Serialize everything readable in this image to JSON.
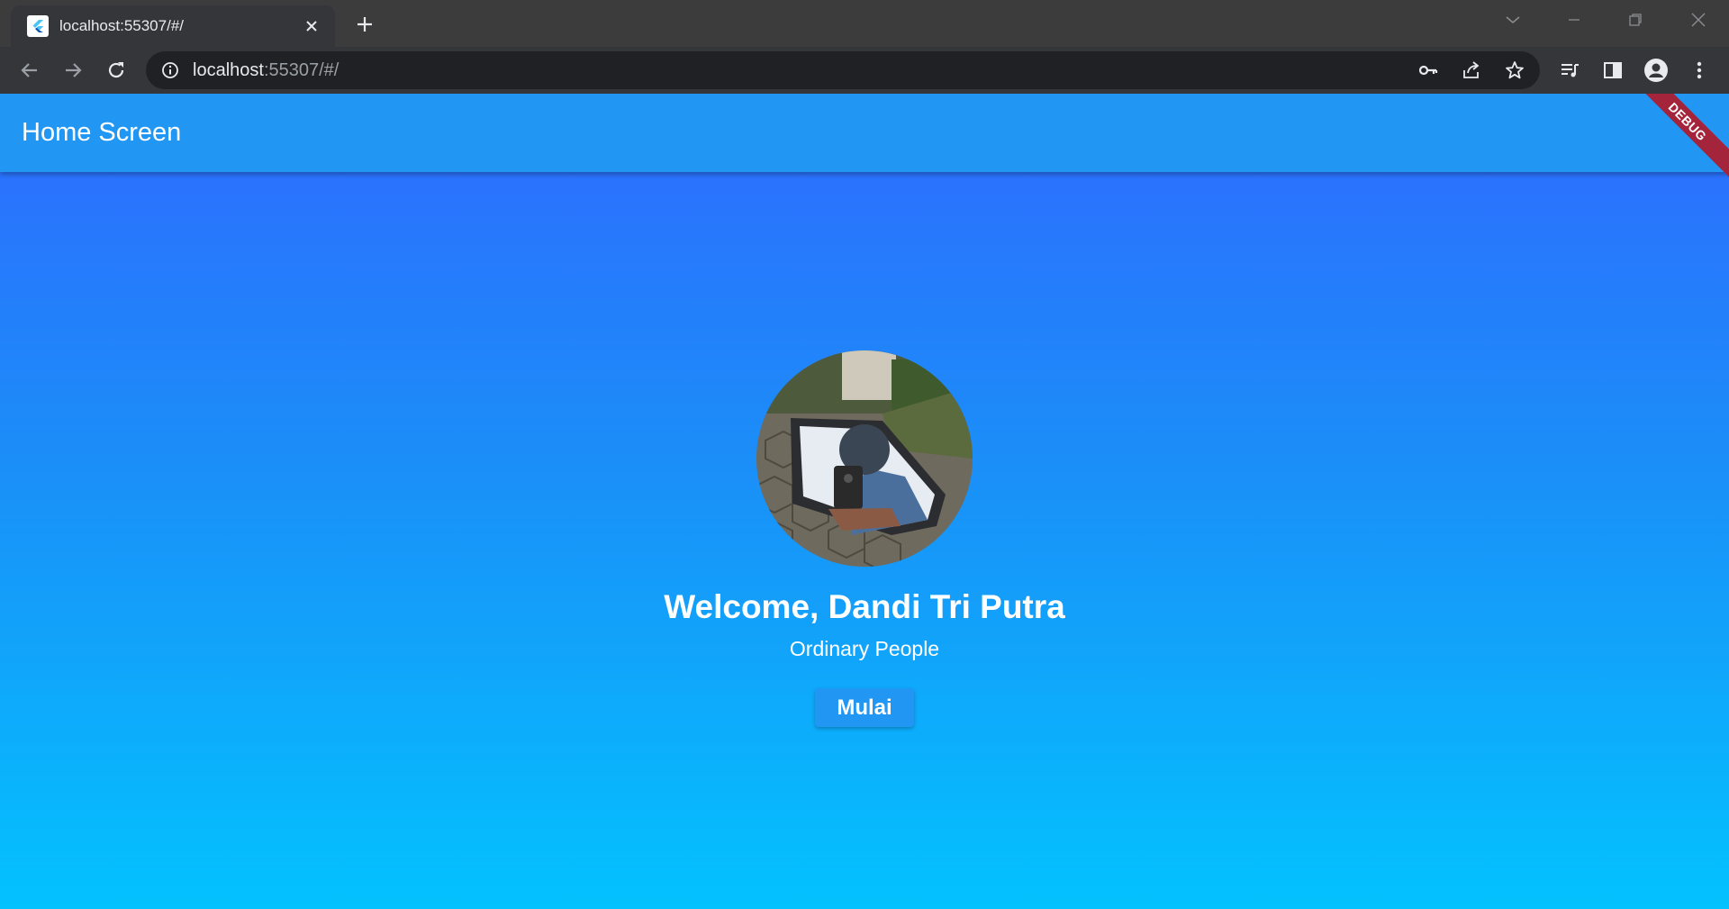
{
  "browser": {
    "tab": {
      "title": "localhost:55307/#/",
      "favicon": "flutter-icon"
    },
    "address_bar": {
      "host": "localhost",
      "path": ":55307/#/"
    },
    "icons": {
      "back": "arrow-left-icon",
      "forward": "arrow-right-icon",
      "reload": "reload-icon",
      "info": "info-icon",
      "password": "key-icon",
      "share": "share-icon",
      "bookmark": "star-icon",
      "media": "media-queue-icon",
      "side_panel": "side-panel-icon",
      "profile": "profile-icon",
      "menu": "kebab-menu-icon"
    }
  },
  "app": {
    "title": "Home Screen",
    "debug_banner": "DEBUG",
    "user": {
      "greeting": "Welcome, Dandi Tri Putra",
      "role": "Ordinary People"
    },
    "start_button": "Mulai",
    "colors": {
      "appbar": "#2196f3",
      "gradient_top": "#2f6bff",
      "gradient_bottom": "#03c2fe",
      "debug_banner": "#a4243b"
    }
  }
}
